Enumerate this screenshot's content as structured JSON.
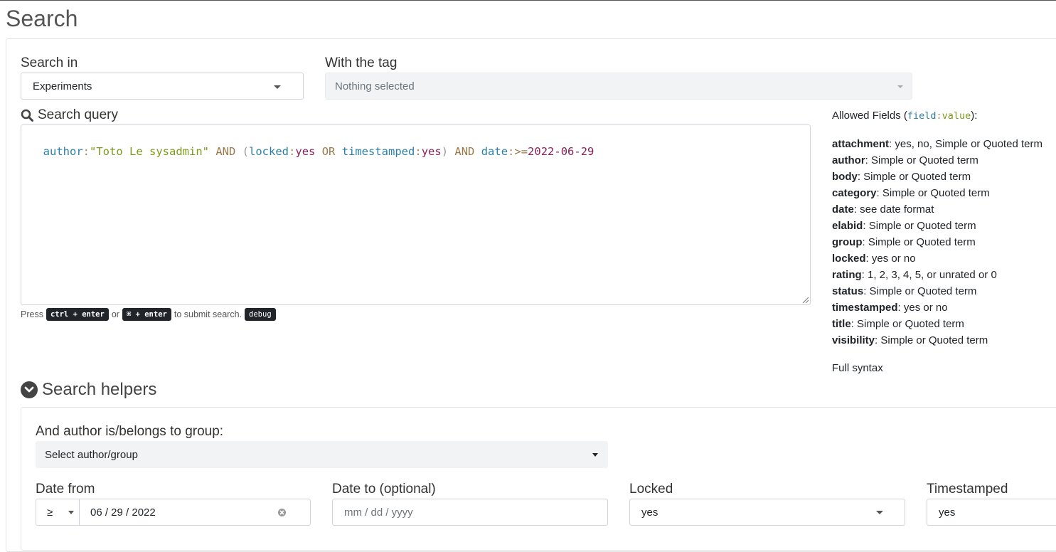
{
  "page": {
    "title": "Search"
  },
  "search_in": {
    "label": "Search in",
    "value": "Experiments"
  },
  "with_tag": {
    "label": "With the tag",
    "value": "Nothing selected"
  },
  "query": {
    "label": "Search query",
    "tokens": [
      {
        "t": "author",
        "k": "tk-field"
      },
      {
        "t": ":",
        "k": "tk-colon"
      },
      {
        "t": "\"Toto Le sysadmin\"",
        "k": "tk-str"
      },
      {
        "t": " AND ",
        "k": "tk-op"
      },
      {
        "t": "(",
        "k": "tk-paren"
      },
      {
        "t": "locked",
        "k": "tk-field"
      },
      {
        "t": ":",
        "k": "tk-colon"
      },
      {
        "t": "yes",
        "k": "tk-val"
      },
      {
        "t": " OR ",
        "k": "tk-op"
      },
      {
        "t": "timestamped",
        "k": "tk-field"
      },
      {
        "t": ":",
        "k": "tk-colon"
      },
      {
        "t": "yes",
        "k": "tk-val"
      },
      {
        "t": ")",
        "k": "tk-paren"
      },
      {
        "t": " AND ",
        "k": "tk-op"
      },
      {
        "t": "date",
        "k": "tk-field"
      },
      {
        "t": ":",
        "k": "tk-colon"
      },
      {
        "t": ">=",
        "k": "tk-op"
      },
      {
        "t": "2022-06-29",
        "k": "tk-val"
      }
    ]
  },
  "hint": {
    "press": "Press",
    "kbd1": "ctrl + enter",
    "or": "or",
    "kbd2": "⌘ + enter",
    "submit": "to submit search.",
    "debug": "debug"
  },
  "allowed": {
    "title_prefix": "Allowed Fields (",
    "code_field": "field",
    "code_colon": ":",
    "code_value": "value",
    "title_suffix": "):",
    "fields": [
      {
        "name": "attachment",
        "desc": ": yes, no, Simple or Quoted term"
      },
      {
        "name": "author",
        "desc": ": Simple or Quoted term"
      },
      {
        "name": "body",
        "desc": ": Simple or Quoted term"
      },
      {
        "name": "category",
        "desc": ": Simple or Quoted term"
      },
      {
        "name": "date",
        "desc": ": see date format"
      },
      {
        "name": "elabid",
        "desc": ": Simple or Quoted term"
      },
      {
        "name": "group",
        "desc": ": Simple or Quoted term"
      },
      {
        "name": "locked",
        "desc": ": yes or no"
      },
      {
        "name": "rating",
        "desc": ": 1, 2, 3, 4, 5, or unrated or 0"
      },
      {
        "name": "status",
        "desc": ": Simple or Quoted term"
      },
      {
        "name": "timestamped",
        "desc": ": yes or no"
      },
      {
        "name": "title",
        "desc": ": Simple or Quoted term"
      },
      {
        "name": "visibility",
        "desc": ": Simple or Quoted term"
      }
    ],
    "full_syntax": "Full syntax"
  },
  "helpers": {
    "title": "Search helpers",
    "author_label": "And author is/belongs to group:",
    "author_value": "Select author/group",
    "date_from_label": "Date from",
    "date_from_op": "≥",
    "date_from_value": "06 / 29 / 2022",
    "date_to_label": "Date to (optional)",
    "date_to_placeholder": "mm / dd / yyyy",
    "locked_label": "Locked",
    "locked_value": "yes",
    "timestamped_label": "Timestamped",
    "timestamped_value": "yes"
  }
}
